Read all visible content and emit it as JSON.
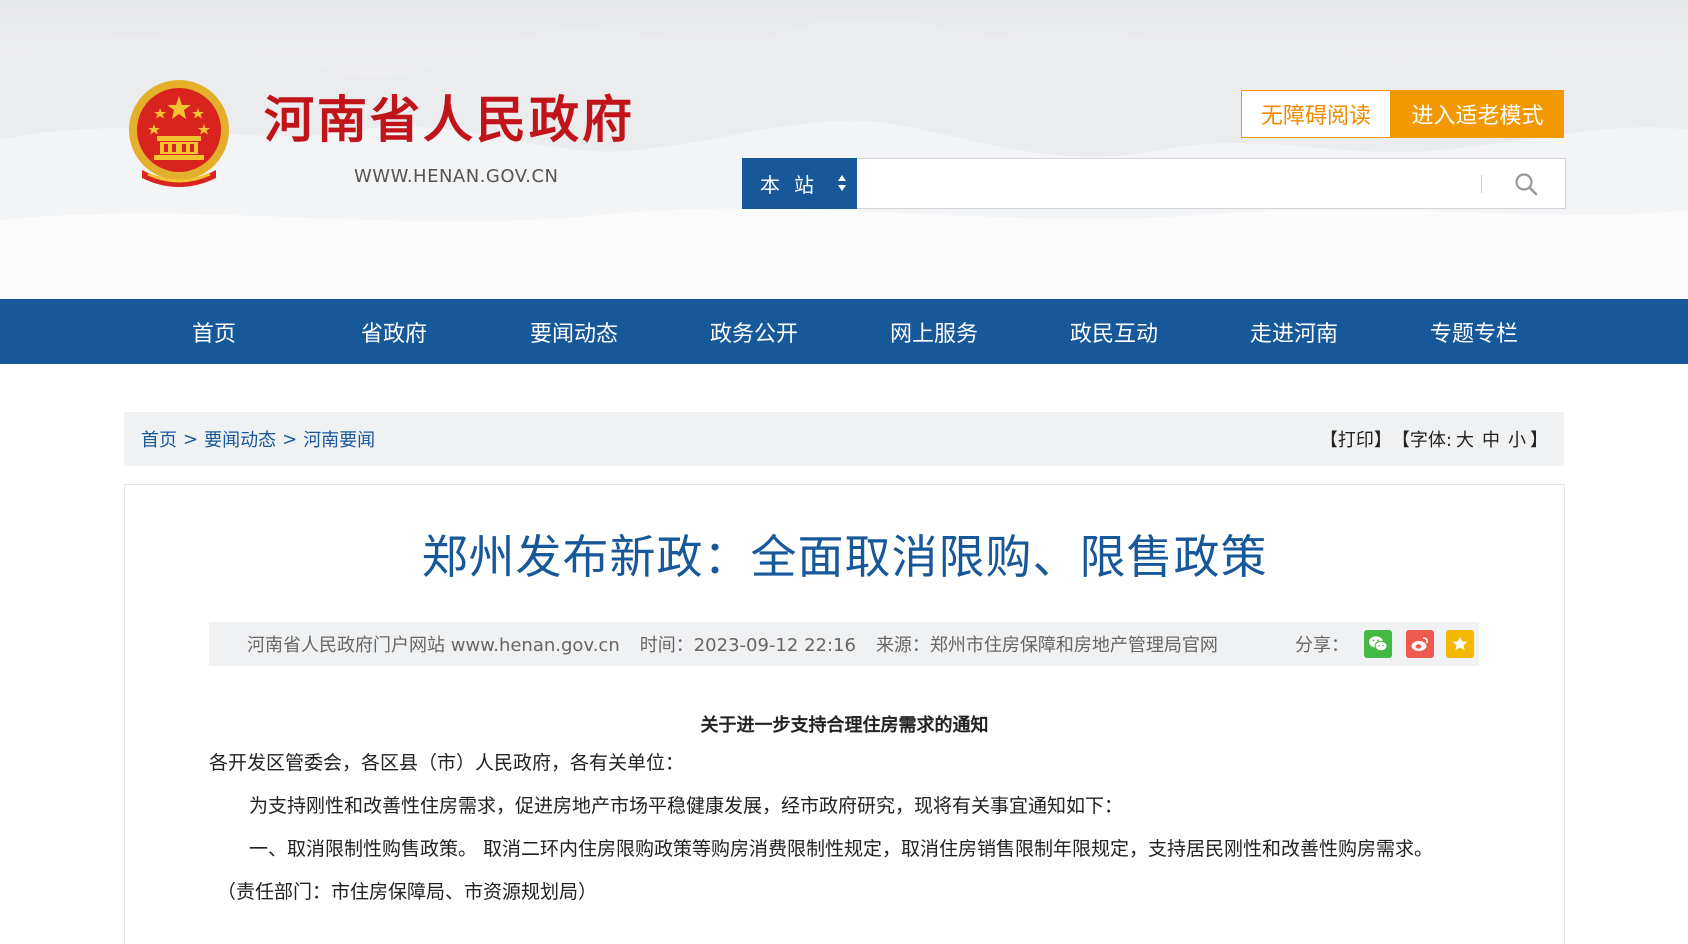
{
  "header": {
    "site_title": "河南省人民政府",
    "site_url": "WWW.HENAN.GOV.CN",
    "accessibility_label": "无障碍阅读",
    "elder_mode_label": "进入适老模式",
    "search": {
      "scope_label": "本站",
      "placeholder": "",
      "value": ""
    }
  },
  "nav": {
    "items": [
      {
        "label": "首页"
      },
      {
        "label": "省政府"
      },
      {
        "label": "要闻动态"
      },
      {
        "label": "政务公开"
      },
      {
        "label": "网上服务"
      },
      {
        "label": "政民互动"
      },
      {
        "label": "走进河南"
      },
      {
        "label": "专题专栏"
      }
    ]
  },
  "breadcrumb": {
    "items": [
      "首页",
      "要闻动态",
      "河南要闻"
    ],
    "separator": ">"
  },
  "tools": {
    "print": "【打印】",
    "font_open": "【字体:",
    "font_large": "大",
    "font_medium": "中",
    "font_small": "小",
    "font_close": "】"
  },
  "article": {
    "title": "郑州发布新政：全面取消限购、限售政策",
    "meta": {
      "source_site": "河南省人民政府门户网站 www.henan.gov.cn",
      "time": "时间：2023-09-12 22:16",
      "origin": "来源：郑州市住房保障和房地产管理局官网",
      "share_label": "分享："
    },
    "doc_title": "关于进一步支持合理住房需求的通知",
    "paragraphs": [
      "各开发区管委会，各区县（市）人民政府，各有关单位：",
      "为支持刚性和改善性住房需求，促进房地产市场平稳健康发展，经市政府研究，现将有关事宜通知如下：",
      "一、取消限制性购售政策。 取消二环内住房限购政策等购房消费限制性规定，取消住房销售限制年限规定，支持居民刚性和改善性购房需求。",
      "（责任部门：市住房保障局、市资源规划局）"
    ]
  },
  "colors": {
    "brand_blue": "#17589a",
    "title_red": "#c0141a",
    "accent_orange": "#f39800"
  },
  "icons": {
    "emblem": "national-emblem-icon",
    "search": "search-icon",
    "scope_toggle": "sort-arrows-icon",
    "share": [
      "wechat-icon",
      "weibo-icon",
      "favorite-star-icon"
    ]
  }
}
